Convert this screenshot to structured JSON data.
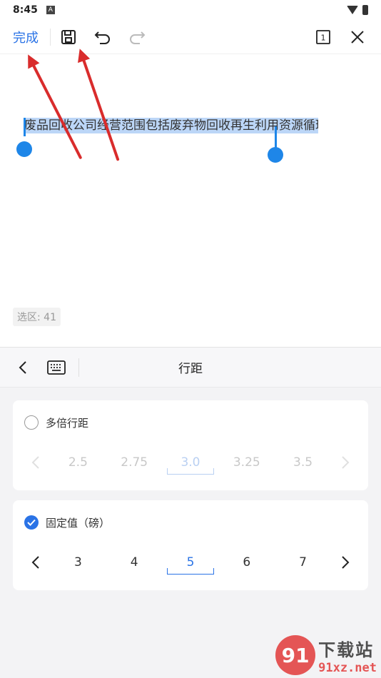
{
  "status": {
    "time": "8:45",
    "notif_glyph": "A"
  },
  "toolbar": {
    "done_label": "完成",
    "page_count": "1",
    "icons": [
      "save-icon",
      "undo-icon",
      "redo-icon",
      "page-count-icon",
      "close-icon"
    ]
  },
  "document": {
    "selected_text": "废品回收公司经营范围包括废弃物回收再生利用资源循环利用处理处置"
  },
  "selection": {
    "label": "选区: 41"
  },
  "panel": {
    "title": "行距"
  },
  "multiple": {
    "label": "多倍行距",
    "checked": false,
    "values": [
      "2.5",
      "2.75",
      "3.0",
      "3.25",
      "3.5"
    ],
    "selected_index": 2
  },
  "fixed": {
    "label": "固定值（磅）",
    "checked": true,
    "values": [
      "3",
      "4",
      "5",
      "6",
      "7"
    ],
    "selected_index": 2
  },
  "watermark": {
    "cn": "下载站",
    "url": "91xz.net",
    "logo": "91"
  },
  "colors": {
    "accent": "#2a73e6",
    "handle": "#1e86e8",
    "arrow": "#d92c2c"
  }
}
